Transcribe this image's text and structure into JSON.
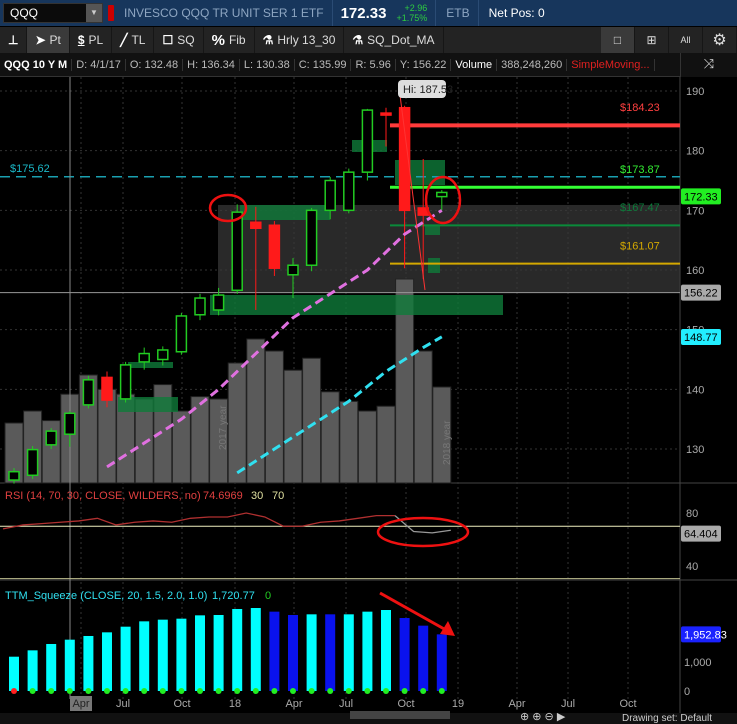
{
  "header": {
    "symbol": "QQQ",
    "description": "INVESCO QQQ TR UNIT SER 1 ETF",
    "last": "172.33",
    "change": "+2.96",
    "change_pct": "+1.75%",
    "etb": "ETB",
    "net_pos": "Net Pos: 0"
  },
  "toolbar": {
    "pin": "pin",
    "pt": "Pt",
    "pl": "PL",
    "tl": "TL",
    "sq": "SQ",
    "fib": "Fib",
    "study1": "Hrly 13_30",
    "study2": "SQ_Dot_MA",
    "all": "All"
  },
  "info": {
    "title": "QQQ 10 Y M",
    "date": "D: 4/1/17",
    "open": "O: 132.48",
    "high": "H: 136.34",
    "low": "L: 130.38",
    "close": "C: 135.99",
    "range": "R: 5.96",
    "y": "Y: 156.22",
    "volume_label": "Volume",
    "volume": "388,248,260",
    "sma": "SimpleMoving..."
  },
  "price_axis": {
    "ticks": [
      "190",
      "180",
      "170",
      "160",
      "150",
      "140",
      "130"
    ],
    "tags": {
      "last": "172.33",
      "crosshair": "156.22",
      "ma": "148.77"
    }
  },
  "levels": {
    "left_label": "$175.62",
    "r1": "$184.23",
    "r2": "$173.87",
    "r3": "$167.47",
    "r4": "$161.07"
  },
  "hi_bubble": "Hi: 187.53",
  "year_labels": [
    "2017 year",
    "2018 year"
  ],
  "rsi": {
    "title": "RSI (14, 70, 30, CLOSE, WILDERS, no)",
    "value": "74.6969",
    "os": "30",
    "ob": "70",
    "ticks": [
      "80",
      "40"
    ],
    "last_tag": "64.404",
    "values": [
      68,
      71,
      72,
      73,
      74,
      76,
      71,
      73,
      74,
      73,
      76,
      77,
      77,
      80,
      77,
      70,
      70,
      73,
      74,
      76,
      78,
      78,
      66,
      65,
      67
    ]
  },
  "squeeze": {
    "title": "TTM_Squeeze (CLOSE, 20, 1.5, 2.0, 1.0)",
    "value": "1,720.77",
    "zero": "0",
    "ticks": [
      "1,000",
      "0"
    ],
    "last_tag": "1,952.83",
    "values": [
      1183,
      1402,
      1621,
      1770,
      1897,
      2023,
      2218,
      2402,
      2460,
      2494,
      2609,
      2621,
      2828,
      2862,
      2736,
      2621,
      2644,
      2644,
      2644,
      2736,
      2793,
      2517,
      2253,
      1953
    ],
    "colors": [
      "c",
      "c",
      "c",
      "c",
      "c",
      "c",
      "c",
      "c",
      "c",
      "c",
      "c",
      "c",
      "c",
      "c",
      "b",
      "b",
      "c",
      "b",
      "c",
      "c",
      "c",
      "b",
      "b",
      "b"
    ],
    "dots": [
      "r",
      "g",
      "g",
      "g",
      "g",
      "g",
      "g",
      "g",
      "g",
      "g",
      "g",
      "g",
      "g",
      "g",
      "g",
      "g",
      "g",
      "g",
      "g",
      "g",
      "g",
      "g",
      "g",
      "g"
    ]
  },
  "time_axis": [
    "Apr",
    "Jul",
    "Oct",
    "18",
    "Apr",
    "Jul",
    "Oct",
    "19",
    "Apr",
    "Jul",
    "Oct"
  ],
  "bottom": {
    "drawing_set": "Drawing set: Default"
  },
  "chart_data": {
    "type": "candlestick",
    "ohlc": [
      [
        124.8,
        126.8,
        124.2,
        126.2
      ],
      [
        125.6,
        130.5,
        125,
        129.9
      ],
      [
        130.7,
        133.5,
        130,
        133
      ],
      [
        132.48,
        136.34,
        130.38,
        135.99
      ],
      [
        137.4,
        142.3,
        136.8,
        141.6
      ],
      [
        142,
        143,
        137,
        138.2
      ],
      [
        138.4,
        144.6,
        137.8,
        144.1
      ],
      [
        144.6,
        147,
        143.3,
        146
      ],
      [
        145,
        147.2,
        144,
        146.6
      ],
      [
        146.3,
        152.8,
        145.8,
        152.3
      ],
      [
        152.5,
        156,
        151.6,
        155.3
      ],
      [
        153.3,
        157,
        152.4,
        155.8
      ],
      [
        156.6,
        171,
        156,
        169.7
      ],
      [
        168,
        170.6,
        153.3,
        167
      ],
      [
        167.5,
        168.2,
        159,
        160.3
      ],
      [
        159.2,
        162,
        155.3,
        160.8
      ],
      [
        160.8,
        170.4,
        159.8,
        170
      ],
      [
        170,
        175.6,
        168.5,
        175
      ],
      [
        170,
        177,
        169.5,
        176.4
      ],
      [
        176.4,
        187,
        175,
        186.8
      ],
      [
        186.3,
        187.2,
        180.7,
        186
      ],
      [
        187.2,
        187.53,
        160.3,
        170
      ],
      [
        170.4,
        178.6,
        158.5,
        169.2
      ],
      [
        172.3,
        173.4,
        170,
        173
      ]
    ],
    "sma_pink": [
      null,
      null,
      null,
      null,
      null,
      127,
      129,
      131,
      133,
      135,
      137.5,
      140,
      143,
      146,
      149,
      152,
      154,
      156,
      158,
      160,
      163,
      166,
      168,
      170
    ],
    "sma_cyan": [
      null,
      null,
      null,
      null,
      null,
      null,
      null,
      null,
      null,
      null,
      null,
      null,
      126,
      128,
      130,
      132,
      134,
      136,
      138,
      140.5,
      143,
      145,
      147,
      148.8
    ],
    "volume_rel": [
      0.25,
      0.3,
      0.26,
      0.37,
      0.45,
      0.39,
      0.37,
      0.35,
      0.41,
      0.3,
      0.36,
      0.35,
      0.5,
      0.6,
      0.55,
      0.47,
      0.52,
      0.38,
      0.34,
      0.3,
      0.32,
      0.85,
      0.55,
      0.4
    ]
  }
}
